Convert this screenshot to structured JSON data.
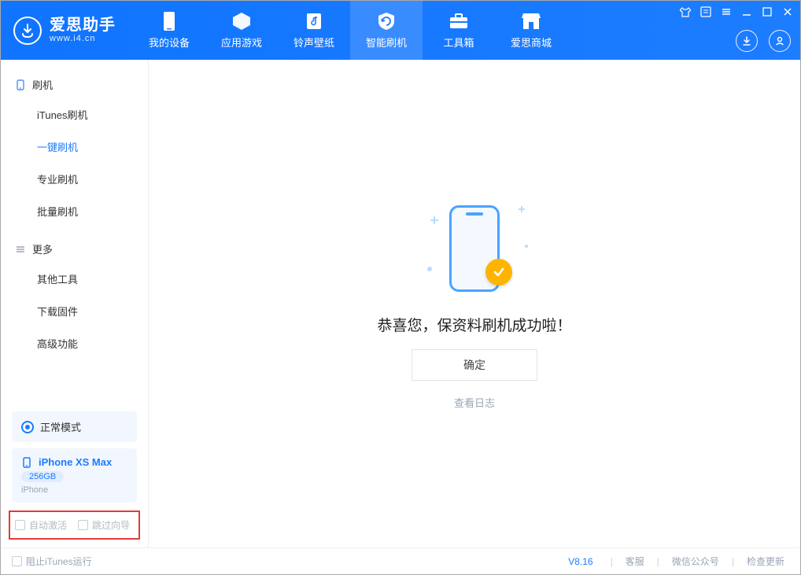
{
  "app": {
    "title": "爱思助手",
    "subtitle": "www.i4.cn"
  },
  "nav": {
    "tabs": [
      {
        "label": "我的设备"
      },
      {
        "label": "应用游戏"
      },
      {
        "label": "铃声壁纸"
      },
      {
        "label": "智能刷机"
      },
      {
        "label": "工具箱"
      },
      {
        "label": "爱思商城"
      }
    ],
    "active_index": 3
  },
  "sidebar": {
    "section_flash": "刷机",
    "items_flash": [
      "iTunes刷机",
      "一键刷机",
      "专业刷机",
      "批量刷机"
    ],
    "active_flash_index": 1,
    "section_more": "更多",
    "items_more": [
      "其他工具",
      "下载固件",
      "高级功能"
    ]
  },
  "mode": {
    "label": "正常模式"
  },
  "device": {
    "name": "iPhone XS Max",
    "capacity": "256GB",
    "type": "iPhone"
  },
  "options": {
    "auto_activate": "自动激活",
    "skip_guide": "跳过向导"
  },
  "main": {
    "success_title": "恭喜您，保资料刷机成功啦！",
    "confirm": "确定",
    "view_log": "查看日志"
  },
  "footer": {
    "block_itunes": "阻止iTunes运行",
    "version": "V8.16",
    "links": [
      "客服",
      "微信公众号",
      "检查更新"
    ]
  }
}
